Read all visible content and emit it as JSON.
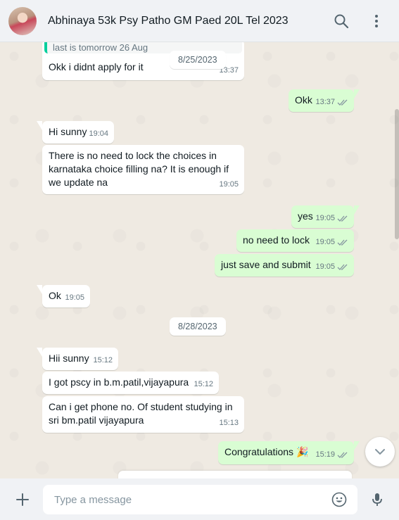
{
  "header": {
    "title": "Abhinaya 53k Psy Patho GM Paed 20L Tel 2023",
    "icons": [
      "avatar",
      "search-icon",
      "menu-icon"
    ]
  },
  "chat": {
    "quoted_preview": "last is tomorrow 26 Aug",
    "messages": [
      {
        "dir": "in",
        "text": "Okk i didnt apply for it",
        "time": "13:37"
      },
      {
        "dir": "out",
        "text": "Okk",
        "time": "13:37",
        "status": "read"
      },
      {
        "dir": "in",
        "text": "Hi sunny",
        "time": "19:04"
      },
      {
        "dir": "in",
        "text": "There is no need to lock the choices in\nkarnataka choice filling na? It is enough if\nwe update na",
        "time": "19:05"
      },
      {
        "dir": "out",
        "text": "yes",
        "time": "19:05",
        "status": "read"
      },
      {
        "dir": "out",
        "text": "no need to lock",
        "time": "19:05",
        "status": "read"
      },
      {
        "dir": "out",
        "text": "just save and submit",
        "time": "19:05",
        "status": "read"
      },
      {
        "dir": "in",
        "text": "Ok",
        "time": "19:05"
      },
      {
        "dir": "in",
        "text": "Hii sunny",
        "time": "15:12"
      },
      {
        "dir": "in",
        "text": "I got pscy in b.m.patil,vijayapura",
        "time": "15:12"
      },
      {
        "dir": "in",
        "text": "Can i get phone no. Of student studying in\nsri bm.patil vijayapura",
        "time": "15:13"
      },
      {
        "dir": "out",
        "text": "Congratulations 🎉",
        "time": "15:19",
        "status": "read"
      }
    ],
    "date_chips": [
      "8/25/2023",
      "8/28/2023"
    ]
  },
  "composer": {
    "placeholder": "Type a message",
    "value": ""
  },
  "colors": {
    "incoming": "#ffffff",
    "outgoing": "#d9fdd3",
    "background": "#efeae2",
    "tick_read": "#53bdeb",
    "tick_grey": "#8696a0"
  }
}
